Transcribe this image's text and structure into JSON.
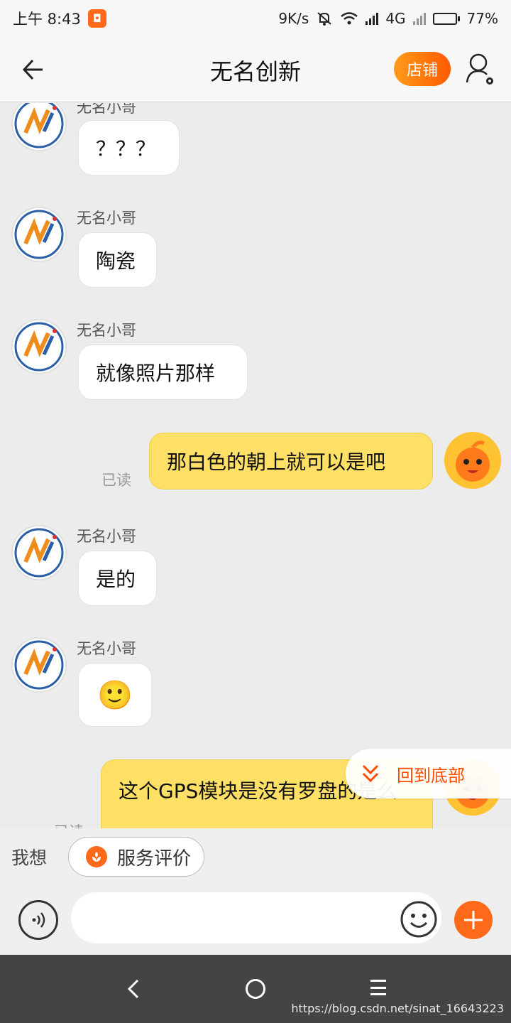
{
  "status_bar": {
    "time": "上午 8:43",
    "net_speed": "9K/s",
    "network": "4G",
    "battery": "77%",
    "battery_level": 0.77
  },
  "header": {
    "title": "无名创新",
    "shop_label": "店铺"
  },
  "chat": {
    "messages": [
      {
        "direction": "in",
        "sender": "无名小哥",
        "text": "？？？"
      },
      {
        "direction": "in",
        "sender": "无名小哥",
        "text": "陶瓷"
      },
      {
        "direction": "in",
        "sender": "无名小哥",
        "text": "就像照片那样"
      },
      {
        "direction": "out",
        "text": "那白色的朝上就可以是吧",
        "status": "已读"
      },
      {
        "direction": "in",
        "sender": "无名小哥",
        "text": "是的"
      },
      {
        "direction": "in",
        "sender": "无名小哥",
        "text": "🙂"
      },
      {
        "direction": "out",
        "text": "这个GPS模块是没有罗盘的是么",
        "status": "已读"
      }
    ],
    "jump_to_bottom": "回到底部"
  },
  "quick_bar": {
    "want_label": "我想",
    "rate_label": "服务评价"
  },
  "input": {
    "placeholder": ""
  },
  "watermark": "https://blog.csdn.net/sinat_16643223",
  "colors": {
    "accent": "#ff5a00",
    "out_bubble": "#ffe066",
    "nav_bar": "#444444"
  }
}
